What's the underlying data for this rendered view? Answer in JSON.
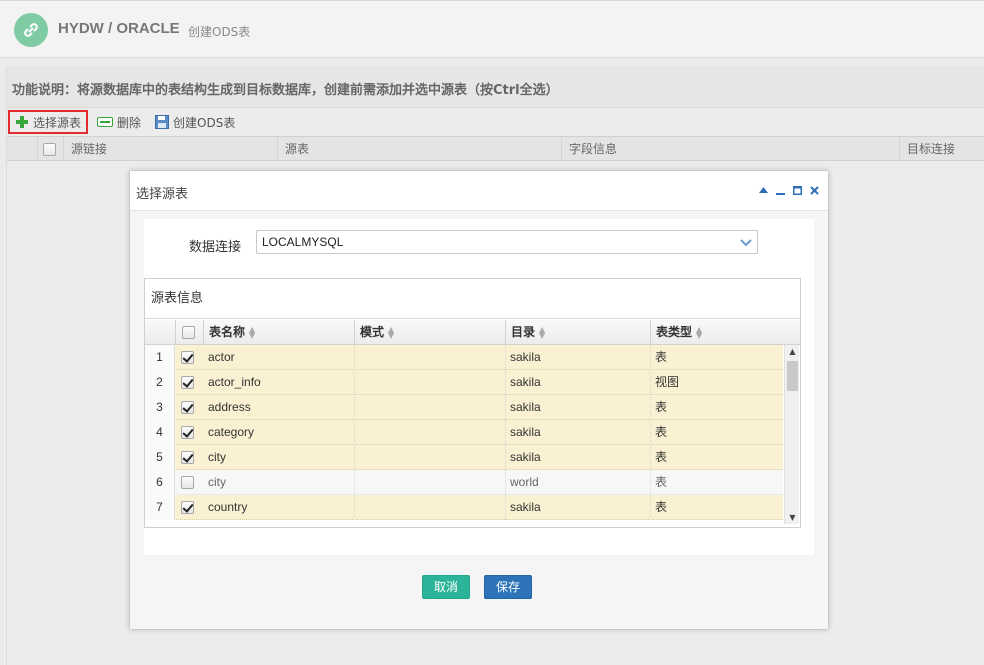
{
  "header": {
    "title": "HYDW / ORACLE",
    "subtitle": "创建ODS表",
    "logo_icon": "link-icon",
    "logo_color": "#7fcba4"
  },
  "description": "功能说明：将源数据库中的表结构生成到目标数据库，创建前需添加并选中源表（按Ctrl全选）",
  "toolbar": {
    "select_source": "选择源表",
    "delete": "删除",
    "create_ods": "创建ODS表"
  },
  "main_grid": {
    "columns": [
      "源链接",
      "源表",
      "字段信息",
      "目标连接"
    ]
  },
  "dialog": {
    "title": "选择源表",
    "connection_label": "数据连接",
    "connection_value": "LOCALMYSQL",
    "panel_title": "源表信息",
    "columns": [
      "表名称",
      "模式",
      "目录",
      "表类型"
    ],
    "rows": [
      {
        "num": "1",
        "checked": true,
        "name": "actor",
        "schema": "",
        "catalog": "sakila",
        "type": "表"
      },
      {
        "num": "2",
        "checked": true,
        "name": "actor_info",
        "schema": "",
        "catalog": "sakila",
        "type": "视图"
      },
      {
        "num": "3",
        "checked": true,
        "name": "address",
        "schema": "",
        "catalog": "sakila",
        "type": "表"
      },
      {
        "num": "4",
        "checked": true,
        "name": "category",
        "schema": "",
        "catalog": "sakila",
        "type": "表"
      },
      {
        "num": "5",
        "checked": true,
        "name": "city",
        "schema": "",
        "catalog": "sakila",
        "type": "表"
      },
      {
        "num": "6",
        "checked": false,
        "name": "city",
        "schema": "",
        "catalog": "world",
        "type": "表"
      },
      {
        "num": "7",
        "checked": true,
        "name": "country",
        "schema": "",
        "catalog": "sakila",
        "type": "表"
      }
    ],
    "cancel_label": "取消",
    "save_label": "保存"
  },
  "colors": {
    "selected_row": "#faf0d2",
    "cancel_button": "#2bb49a",
    "save_button": "#2d73b8",
    "highlight_border": "#e02b2b"
  }
}
